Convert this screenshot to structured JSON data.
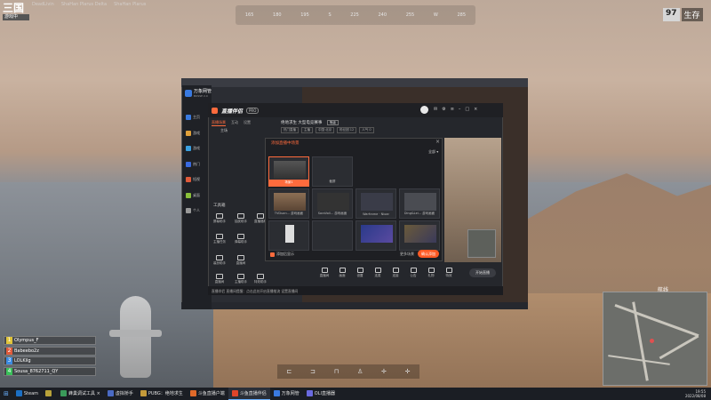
{
  "game": {
    "logo_text": "三国",
    "logo_sub": "游戏中",
    "top_tabs": [
      "DeadLivin",
      "ShaHan Plarus Delta",
      "ShaHan Plarus"
    ],
    "compass": [
      "165",
      "180",
      "195",
      "S",
      "225",
      "240",
      "255",
      "W",
      "285"
    ],
    "alive_count": "97",
    "alive_label": "生存",
    "minimap_label": "航线",
    "hotbar": [
      "⊏",
      "⊐",
      "⊓",
      "♙",
      "✛",
      "✛"
    ]
  },
  "squad": [
    {
      "idx": "1",
      "name": "Olympus_F",
      "color": "#e0c43a"
    },
    {
      "idx": "2",
      "name": "Babeebo2z",
      "color": "#e05a3a"
    },
    {
      "idx": "3",
      "name": "LOLKilg",
      "color": "#3a8ae0"
    },
    {
      "idx": "4",
      "name": "Sousa_8762711_QY",
      "color": "#3ac05a"
    }
  ],
  "taskbar": {
    "items": [
      {
        "label": "Steam",
        "color": "#1b6fc4",
        "active": false
      },
      {
        "label": "",
        "color": "#b8a23a",
        "active": false
      },
      {
        "label": "蜂巢调试工具 ×",
        "color": "#3a9a5a",
        "active": false
      },
      {
        "label": "虚拟桥手",
        "color": "#4a6ac4",
        "active": false
      },
      {
        "label": "PUBG：绝地求生",
        "color": "#c49a3a",
        "active": false
      },
      {
        "label": "斗鱼直播户端",
        "color": "#e06a2a",
        "active": false
      },
      {
        "label": "斗鱼直播伴侣",
        "color": "#e0452a",
        "active": true
      },
      {
        "label": "万象网管",
        "color": "#3a7ae0",
        "active": false
      },
      {
        "label": "OLI直播器",
        "color": "#6a6ae0",
        "active": false
      }
    ],
    "clock_time": "19:55",
    "clock_date": "2022/08/08"
  },
  "app": {
    "sidebar_title": "万象网管",
    "sidebar_sub": "BOSSE 2.0",
    "sidebar_items": [
      {
        "label": "主页",
        "color": "#3a7ae0"
      },
      {
        "label": "游戏",
        "color": "#e0a03a"
      },
      {
        "label": "游戏",
        "color": "#3aa0e0"
      },
      {
        "label": "热门",
        "color": "#3a6ae0"
      },
      {
        "label": "短视",
        "color": "#e05a3a"
      },
      {
        "label": "桌面",
        "color": "#8ac03a"
      },
      {
        "label": "个人",
        "color": "#999999"
      }
    ],
    "brand": "直播伴侣",
    "badge": "PRO",
    "tabs": [
      "直播场景",
      "互动",
      "设置"
    ],
    "scene_label": "主场",
    "room_title": "绝地求生 大型电竞赛事",
    "room_tag": "等级",
    "room_meta": [
      "热门直播",
      "主播",
      "中国·北京",
      "粉丝团 12",
      "人气 0"
    ],
    "tools_title": "工具箱",
    "tools": [
      "屏幕助手",
      "抽奖助手",
      "主播任务",
      "弹幕助手",
      "装扮助手",
      "直播间",
      "直播间",
      "主播助手",
      "直播福利",
      "特效助手"
    ],
    "panel_title": "添加直播中场景",
    "panel_filter": "全部",
    "tiles": [
      {
        "label": "场景1",
        "selected": true
      },
      {
        "label": "截屏",
        "selected": false
      },
      {
        "label": "",
        "selected": false
      },
      {
        "label": "",
        "selected": false
      },
      {
        "label": "TVDuan... 游戏画面",
        "selected": false
      },
      {
        "label": "SoraVoll... 游戏画面",
        "selected": false
      },
      {
        "label": "Warframe · Nioar",
        "selected": false
      },
      {
        "label": "Ding&Lei... 游戏画面",
        "selected": false
      },
      {
        "label": "",
        "selected": false
      },
      {
        "label": "",
        "selected": false
      },
      {
        "label": "",
        "selected": false
      },
      {
        "label": "",
        "selected": false
      }
    ],
    "checkbox_label": "添加后显示",
    "add_link": "更多场景",
    "add_button": "确认添加",
    "bottom": [
      "直播间",
      "画面",
      "设置",
      "连麦",
      "连接",
      "公告",
      "礼物",
      "特效"
    ],
    "start_button": "开始直播",
    "footer": "直播伴侣 直播间提醒：点击此处开启直播推流 设置直播间"
  }
}
